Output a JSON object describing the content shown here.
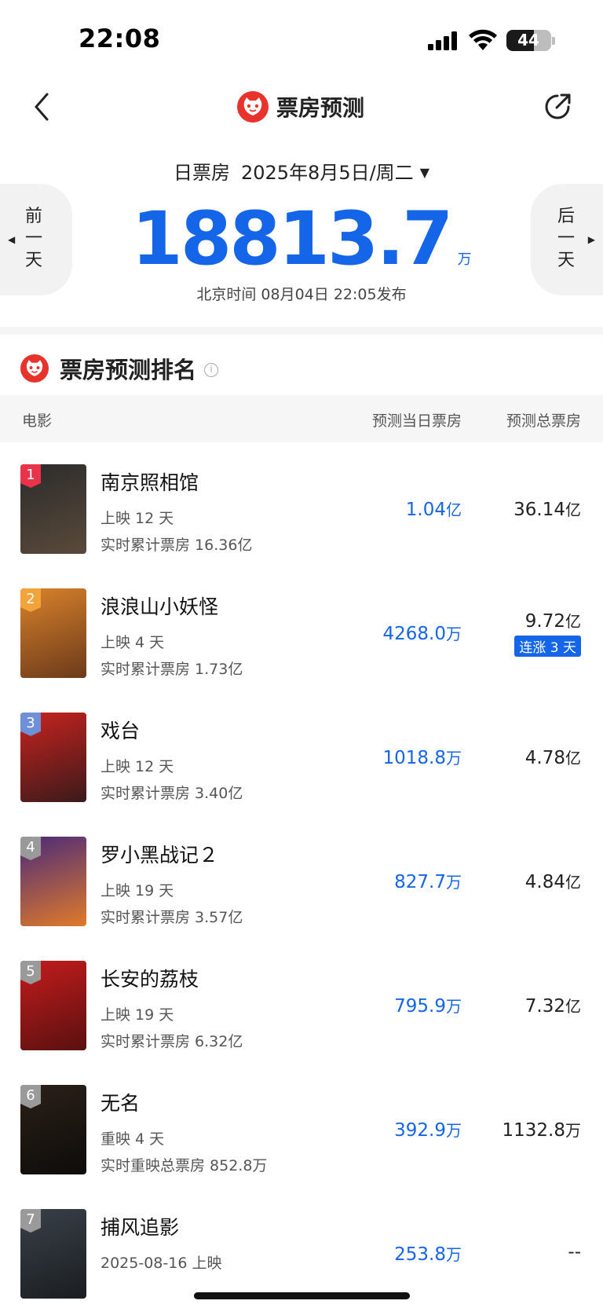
{
  "status_bar": {
    "time": "22:08",
    "battery": "44"
  },
  "nav": {
    "title": "票房预测"
  },
  "date": {
    "label": "日票房",
    "value": "2025年8月5日/周二",
    "caret": "▼"
  },
  "prev_day": {
    "label": [
      "前",
      "一",
      "天"
    ],
    "arrow": "◀"
  },
  "next_day": {
    "label": [
      "后",
      "一",
      "天"
    ],
    "arrow": "▶"
  },
  "total": {
    "value": "18813.7",
    "unit": "万"
  },
  "publish": "北京时间  08月04日  22:05发布",
  "ranking": {
    "title": "票房预测排名",
    "info": "i"
  },
  "table_head": {
    "movie": "电影",
    "day": "预测当日票房",
    "total": "预测总票房"
  },
  "colors": {
    "accent": "#1565e8",
    "brand": "#e8332c"
  },
  "movies": [
    {
      "rank": "1",
      "title": "南京照相馆",
      "sub1": "上映 12 天",
      "sub2": "实时累计票房 16.36亿",
      "day": "1.04",
      "day_unit": "亿",
      "total": "36.14",
      "total_unit": "亿",
      "streak": "",
      "badge": "#e8334a",
      "poster": [
        "#2b2b2b",
        "#5a4a3a"
      ]
    },
    {
      "rank": "2",
      "title": "浪浪山小妖怪",
      "sub1": "上映 4 天",
      "sub2": "实时累计票房 1.73亿",
      "day": "4268.0",
      "day_unit": "万",
      "total": "9.72",
      "total_unit": "亿",
      "streak": "连涨 3 天",
      "badge": "#f2a33a",
      "poster": [
        "#d9822b",
        "#6b3a1a"
      ]
    },
    {
      "rank": "3",
      "title": "戏台",
      "sub1": "上映 12 天",
      "sub2": "实时累计票房 3.40亿",
      "day": "1018.8",
      "day_unit": "万",
      "total": "4.78",
      "total_unit": "亿",
      "streak": "",
      "badge": "#6f8fd6",
      "poster": [
        "#c8231f",
        "#3a1a1a"
      ]
    },
    {
      "rank": "4",
      "title": "罗小黑战记２",
      "sub1": "上映 19 天",
      "sub2": "实时累计票房 3.57亿",
      "day": "827.7",
      "day_unit": "万",
      "total": "4.84",
      "total_unit": "亿",
      "streak": "",
      "badge": "#9a9a9a",
      "poster": [
        "#4a2a7a",
        "#e07a2a"
      ]
    },
    {
      "rank": "5",
      "title": "长安的荔枝",
      "sub1": "上映 19 天",
      "sub2": "实时累计票房 6.32亿",
      "day": "795.9",
      "day_unit": "万",
      "total": "7.32",
      "total_unit": "亿",
      "streak": "",
      "badge": "#9a9a9a",
      "poster": [
        "#c41c1c",
        "#5a1010"
      ]
    },
    {
      "rank": "6",
      "title": "无名",
      "sub1": "重映 4 天",
      "sub2": "实时重映总票房 852.8万",
      "day": "392.9",
      "day_unit": "万",
      "total": "1132.8",
      "total_unit": "万",
      "streak": "",
      "badge": "#9a9a9a",
      "poster": [
        "#2a2018",
        "#0e0c0a"
      ]
    },
    {
      "rank": "7",
      "title": "捕风追影",
      "sub1": "2025-08-16 上映",
      "sub2": "",
      "day": "253.8",
      "day_unit": "万",
      "total": "--",
      "total_unit": "",
      "streak": "",
      "badge": "#9a9a9a",
      "poster": [
        "#3a4048",
        "#1a1e22"
      ]
    }
  ]
}
